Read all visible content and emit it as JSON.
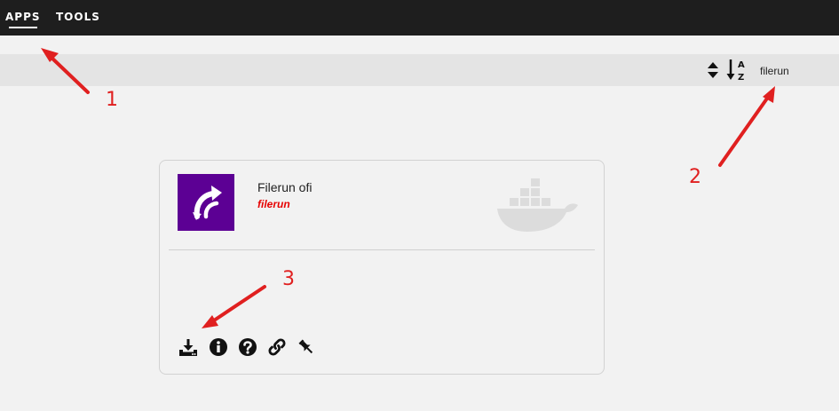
{
  "nav": {
    "tabs": [
      {
        "label": "APPS",
        "active": true
      },
      {
        "label": "TOOLS",
        "active": false
      }
    ]
  },
  "filterbar": {
    "sort_icon": "sort-updown-icon",
    "alpha_icon": "sort-alpha-az-icon",
    "search_value": "filerun"
  },
  "app_card": {
    "name": "Filerun ofi",
    "author": "filerun",
    "logo_color": "#5c0094",
    "author_color": "#e60000",
    "watermark_icon": "docker-icon",
    "actions": [
      "download-install-icon",
      "info-icon",
      "help-icon",
      "link-icon",
      "pin-icon"
    ]
  },
  "annotations": {
    "color": "#e02020",
    "labels": [
      "1",
      "2",
      "3"
    ]
  }
}
